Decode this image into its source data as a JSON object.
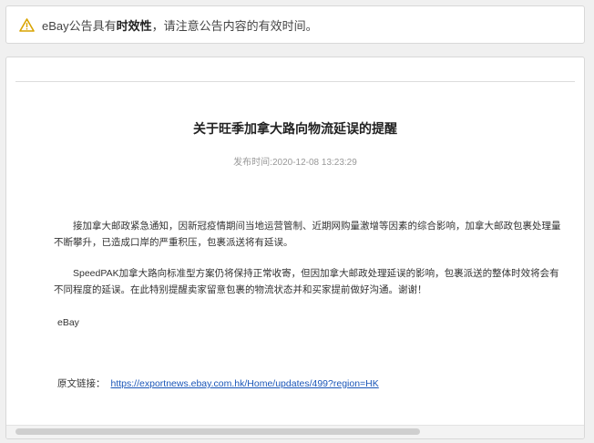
{
  "notice": {
    "prefix": "eBay公告具有",
    "emphasis": "时效性",
    "suffix": "，请注意公告内容的有效时间。",
    "icon": "warning-triangle-icon",
    "icon_color": "#d9a400"
  },
  "article": {
    "title": "关于旺季加拿大路向物流延误的提醒",
    "date": "发布时间:2020-12-08 13:23:29",
    "paragraphs": [
      "接加拿大邮政紧急通知，因新冠疫情期间当地运营管制、近期网购量激增等因素的综合影响，加拿大邮政包裹处理量不断攀升，已造成口岸的严重积压，包裹派送将有延误。",
      "SpeedPAK加拿大路向标准型方案仍将保持正常收寄，但因加拿大邮政处理延误的影响，包裹派送的整体时效将会有不同程度的延误。在此特别提醒卖家留意包裹的物流状态并和买家提前做好沟通。谢谢！"
    ],
    "signature": "eBay",
    "source_label": "原文链接：",
    "source_url": "https://exportnews.ebay.com.hk/Home/updates/499?region=HK",
    "link_color": "#1a56b8"
  }
}
